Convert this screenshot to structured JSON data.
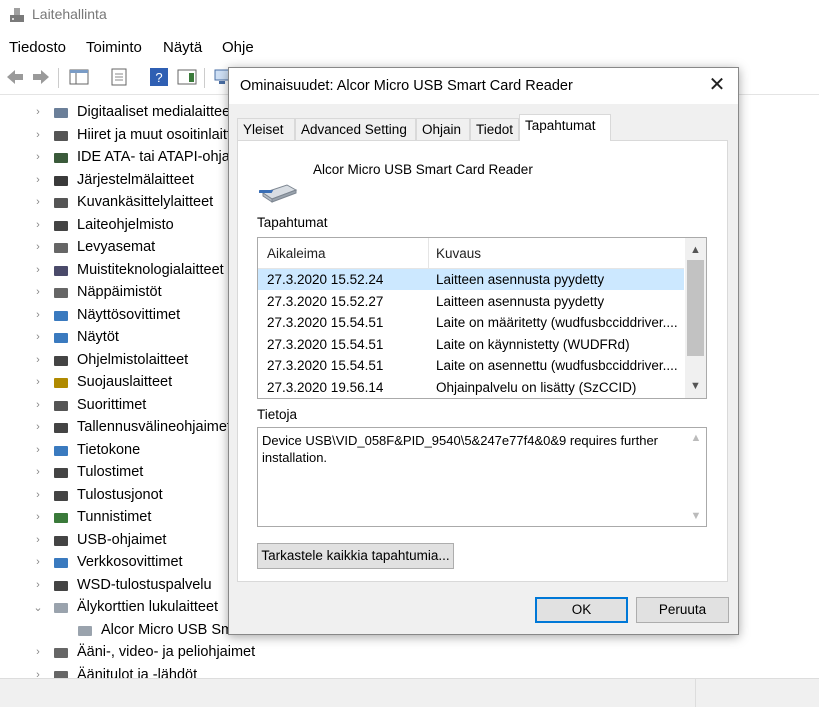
{
  "window": {
    "title": "Laitehallinta"
  },
  "menu": [
    {
      "label": "Tiedosto"
    },
    {
      "label": "Toiminto"
    },
    {
      "label": "Näytä"
    },
    {
      "label": "Ohje"
    }
  ],
  "tree": {
    "items": [
      {
        "label": "Digitaaliset medialaitteet",
        "icon": "media-device-icon"
      },
      {
        "label": "Hiiret ja muut osoitinlaitteet",
        "icon": "mouse-icon"
      },
      {
        "label": "IDE ATA- tai ATAPI-ohjaimet",
        "icon": "ide-controller-icon"
      },
      {
        "label": "Järjestelmälaitteet",
        "icon": "system-device-icon"
      },
      {
        "label": "Kuvankäsittelylaitteet",
        "icon": "camera-icon"
      },
      {
        "label": "Laiteohjelmisto",
        "icon": "firmware-icon"
      },
      {
        "label": "Levyasemat",
        "icon": "disk-drive-icon"
      },
      {
        "label": "Muistiteknologialaitteet",
        "icon": "memory-device-icon"
      },
      {
        "label": "Näppäimistöt",
        "icon": "keyboard-icon"
      },
      {
        "label": "Näyttösovittimet",
        "icon": "display-adapter-icon"
      },
      {
        "label": "Näytöt",
        "icon": "monitor-icon"
      },
      {
        "label": "Ohjelmistolaitteet",
        "icon": "software-device-icon"
      },
      {
        "label": "Suojauslaitteet",
        "icon": "security-device-icon"
      },
      {
        "label": "Suorittimet",
        "icon": "processor-icon"
      },
      {
        "label": "Tallennusvälineohjaimet",
        "icon": "storage-controller-icon"
      },
      {
        "label": "Tietokone",
        "icon": "computer-icon"
      },
      {
        "label": "Tulostimet",
        "icon": "printer-icon"
      },
      {
        "label": "Tulostusjonot",
        "icon": "print-queue-icon"
      },
      {
        "label": "Tunnistimet",
        "icon": "sensor-icon"
      },
      {
        "label": "USB-ohjaimet",
        "icon": "usb-icon"
      },
      {
        "label": "Verkkosovittimet",
        "icon": "network-adapter-icon"
      },
      {
        "label": "WSD-tulostuspalvelu",
        "icon": "wsd-printer-icon"
      },
      {
        "label": "Älykorttien lukulaitteet",
        "icon": "smart-card-reader-icon",
        "expanded": true
      },
      {
        "label": "Alcor Micro USB Smart Card Reader",
        "icon": "smart-card-reader-icon",
        "child": true
      },
      {
        "label": "Ääni-, video- ja peliohjaimet",
        "icon": "audio-icon"
      },
      {
        "label": "Äänitulot ja -lähdöt",
        "icon": "audio-io-icon"
      }
    ]
  },
  "dialog": {
    "title": "Ominaisuudet: Alcor Micro USB Smart Card Reader",
    "tabs": [
      {
        "label": "Yleiset"
      },
      {
        "label": "Advanced Setting"
      },
      {
        "label": "Ohjain"
      },
      {
        "label": "Tiedot"
      },
      {
        "label": "Tapahtumat",
        "active": true
      }
    ],
    "device_name": "Alcor Micro USB Smart Card Reader",
    "events_label": "Tapahtumat",
    "columns": {
      "timestamp": "Aikaleima",
      "description": "Kuvaus"
    },
    "events": [
      {
        "timestamp": "27.3.2020 15.52.24",
        "description": "Laitteen asennusta pyydetty",
        "selected": true
      },
      {
        "timestamp": "27.3.2020 15.52.27",
        "description": "Laitteen asennusta pyydetty"
      },
      {
        "timestamp": "27.3.2020 15.54.51",
        "description": "Laite on määritetty (wudfusbcciddriver...."
      },
      {
        "timestamp": "27.3.2020 15.54.51",
        "description": "Laite on käynnistetty (WUDFRd)"
      },
      {
        "timestamp": "27.3.2020 15.54.51",
        "description": "Laite on asennettu (wudfusbcciddriver...."
      },
      {
        "timestamp": "27.3.2020 19.56.14",
        "description": "Ohjainpalvelu on lisätty (SzCCID)"
      }
    ],
    "info_label": "Tietoja",
    "info_text": "Device USB\\VID_058F&PID_9540\\5&247e77f4&0&9 requires further installation.",
    "view_all_button": "Tarkastele kaikkia tapahtumia...",
    "ok_button": "OK",
    "cancel_button": "Peruuta"
  },
  "colors": {
    "selection": "#cce8ff",
    "default_button_border": "#0078d7"
  }
}
